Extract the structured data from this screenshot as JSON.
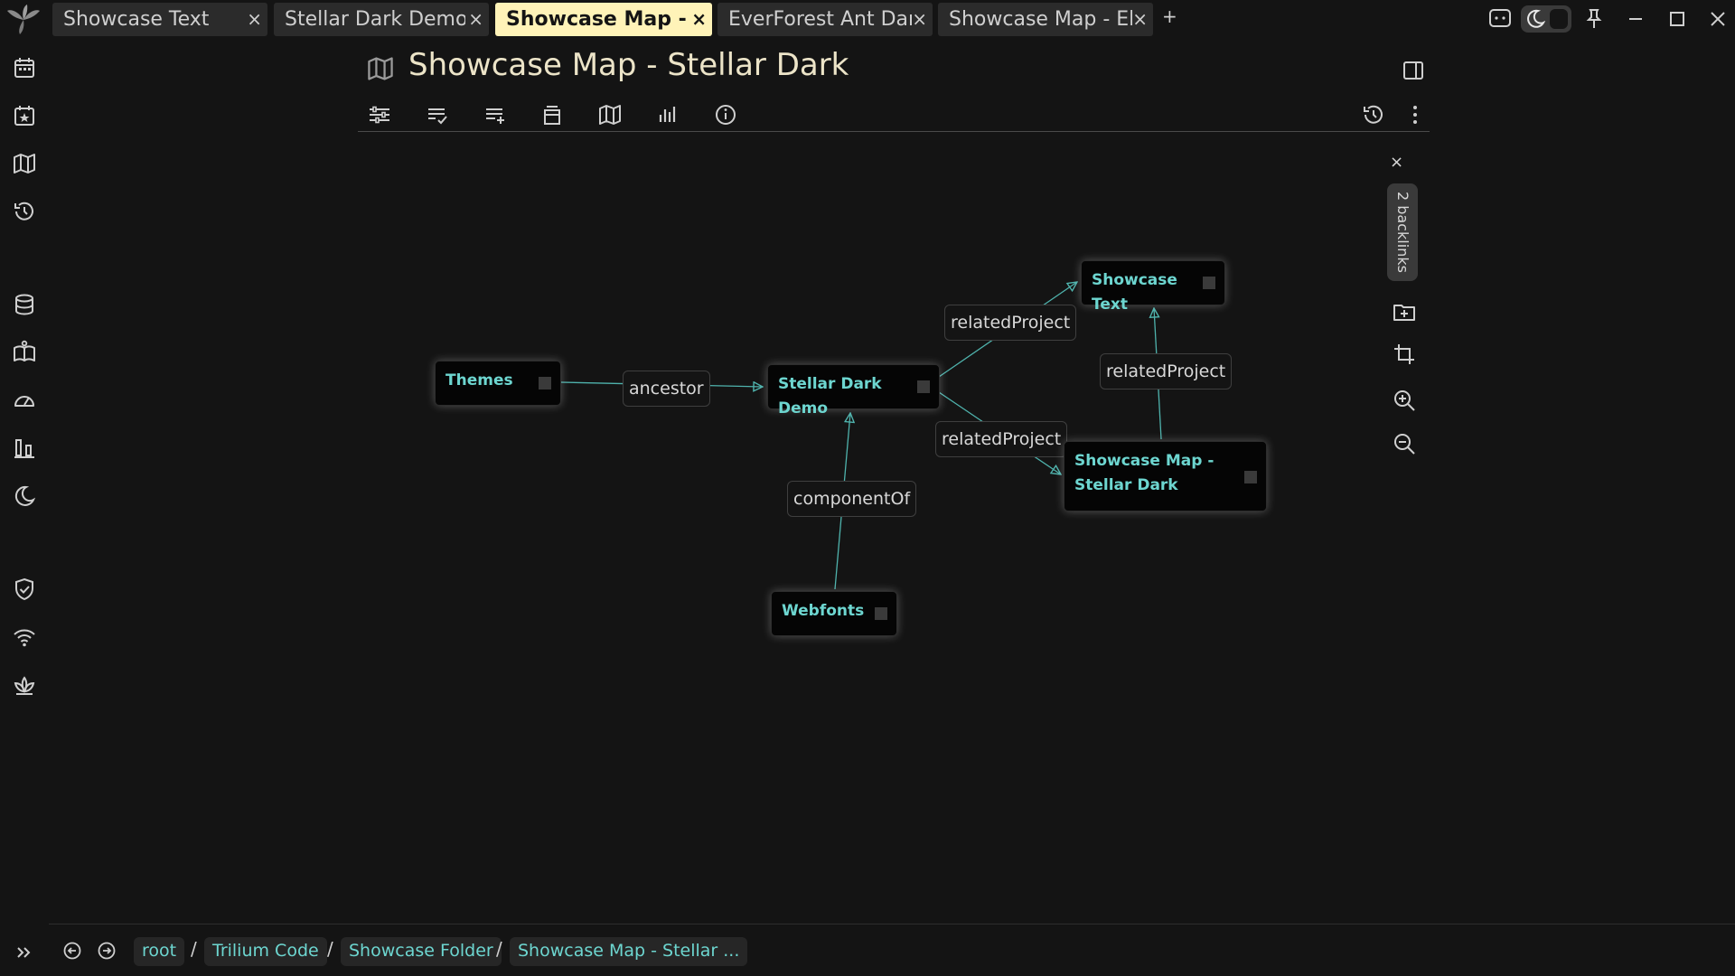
{
  "tabs": [
    {
      "title": "Showcase Text",
      "close": "×",
      "active": false
    },
    {
      "title": "Stellar Dark Demo",
      "close": "×",
      "active": false
    },
    {
      "title": "Showcase Map - St",
      "close": "×",
      "active": true
    },
    {
      "title": "EverForest Ant Dar",
      "close": "×",
      "active": false
    },
    {
      "title": "Showcase Map - El",
      "close": "×",
      "active": false
    }
  ],
  "new_tab": "+",
  "titlebar_icons": [
    "app-logo-icon",
    "chat-bubble-icon",
    "moon-icon",
    "pin-icon",
    "minimize-icon",
    "maximize-icon",
    "close-icon"
  ],
  "launcher_icons": [
    "calendar-icon",
    "calendar-star-icon",
    "map-icon",
    "history-icon",
    "database-icon",
    "book-open-icon",
    "speedometer-icon",
    "bar-chart-icon",
    "moon-icon",
    "shield-check-icon",
    "wifi-icon",
    "lotus-icon"
  ],
  "note": {
    "title": "Showcase Map - Stellar Dark",
    "type_icon": "map-icon"
  },
  "toolbar_icons": [
    "sliders-icon",
    "text-lines-check-icon",
    "list-add-icon",
    "print-icon",
    "map-icon",
    "bar-chart-icon",
    "info-icon",
    "history-icon",
    "more-vertical-icon"
  ],
  "map": {
    "nodes": {
      "themes": "Themes",
      "stellar": "Stellar Dark Demo",
      "webfonts": "Webfonts",
      "showcase_text": "Showcase Text",
      "showcase_map_line1": "Showcase Map -",
      "showcase_map_line2": "Stellar Dark"
    },
    "edges": {
      "ancestor": "ancestor",
      "component_of": "componentOf",
      "related_1": "relatedProject",
      "related_2": "relatedProject",
      "related_3": "relatedProject"
    },
    "close": "×",
    "backlinks": "2 backlinks",
    "buttons": [
      "add-folder-icon",
      "crop-icon",
      "zoom-in-icon",
      "zoom-out-icon"
    ],
    "accent_color": "#6dd6d0"
  },
  "breadcrumbs": [
    "root",
    "Trilium Code",
    "Showcase Folder",
    "Showcase Map - Stellar ..."
  ],
  "breadcrumb_separator": "/",
  "colors": {
    "background": "#141414",
    "active_tab": "#fff3b8",
    "link": "#6dd6d0",
    "title": "#ece4c8"
  }
}
